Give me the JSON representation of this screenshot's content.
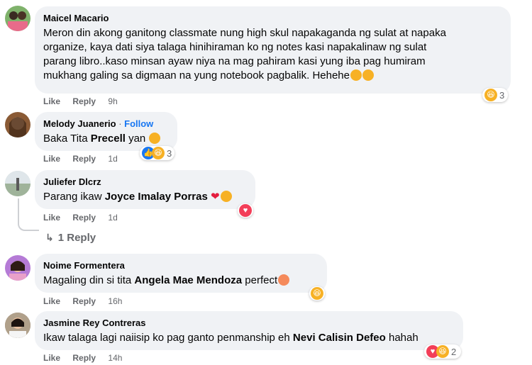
{
  "comments": [
    {
      "name": "Maicel Macario",
      "lines": [
        "Meron din akong ganitong classmate nung high skul napakaganda ng sulat at napaka",
        "organize, kaya dati siya talaga hinihiraman ko ng notes kasi napakalinaw ng sulat",
        "parang libro..kaso minsan ayaw niya na mag pahiram kasi yung iba pag humiram",
        "mukhang galing sa digmaan na yung notebook pagbalik. Hehehe"
      ],
      "like": "Like",
      "reply": "Reply",
      "time": "9h",
      "reaction_count": "3",
      "avatar_color": "#7fb26b"
    },
    {
      "name": "Melody Juanerio",
      "follow": "Follow",
      "text_before": "Baka Tita ",
      "tag": "Precell",
      "text_after": " yan ",
      "like": "Like",
      "reply": "Reply",
      "time": "1d",
      "reaction_count": "3",
      "avatar_color": "#8a5a35"
    },
    {
      "name": "Juliefer Dlcrz",
      "text_before": "Parang ikaw ",
      "tag": "Joyce Imalay Porras",
      "text_after": " ",
      "like": "Like",
      "reply": "Reply",
      "time": "1d",
      "avatar_color": "#c9d3c6",
      "replies_link": "1 Reply"
    },
    {
      "name": "Noime Formentera",
      "text_before": "Magaling din si tita ",
      "tag": "Angela Mae Mendoza",
      "text_after": " perfect",
      "like": "Like",
      "reply": "Reply",
      "time": "16h",
      "avatar_color": "#b57bd6"
    },
    {
      "name": "Jasmine Rey Contreras",
      "text_before": "Ikaw talaga lagi naiisip ko pag ganto penmanship eh ",
      "tag": "Nevi Calisin Defeo",
      "text_after": " hahah",
      "like": "Like",
      "reply": "Reply",
      "time": "14h",
      "reaction_count": "2",
      "avatar_color": "#8c7a6a"
    }
  ],
  "icons": {
    "haha": "haha-emoji",
    "love": "love-emoji",
    "like": "like-emoji",
    "reply_arrow": "reply-arrow-icon"
  }
}
